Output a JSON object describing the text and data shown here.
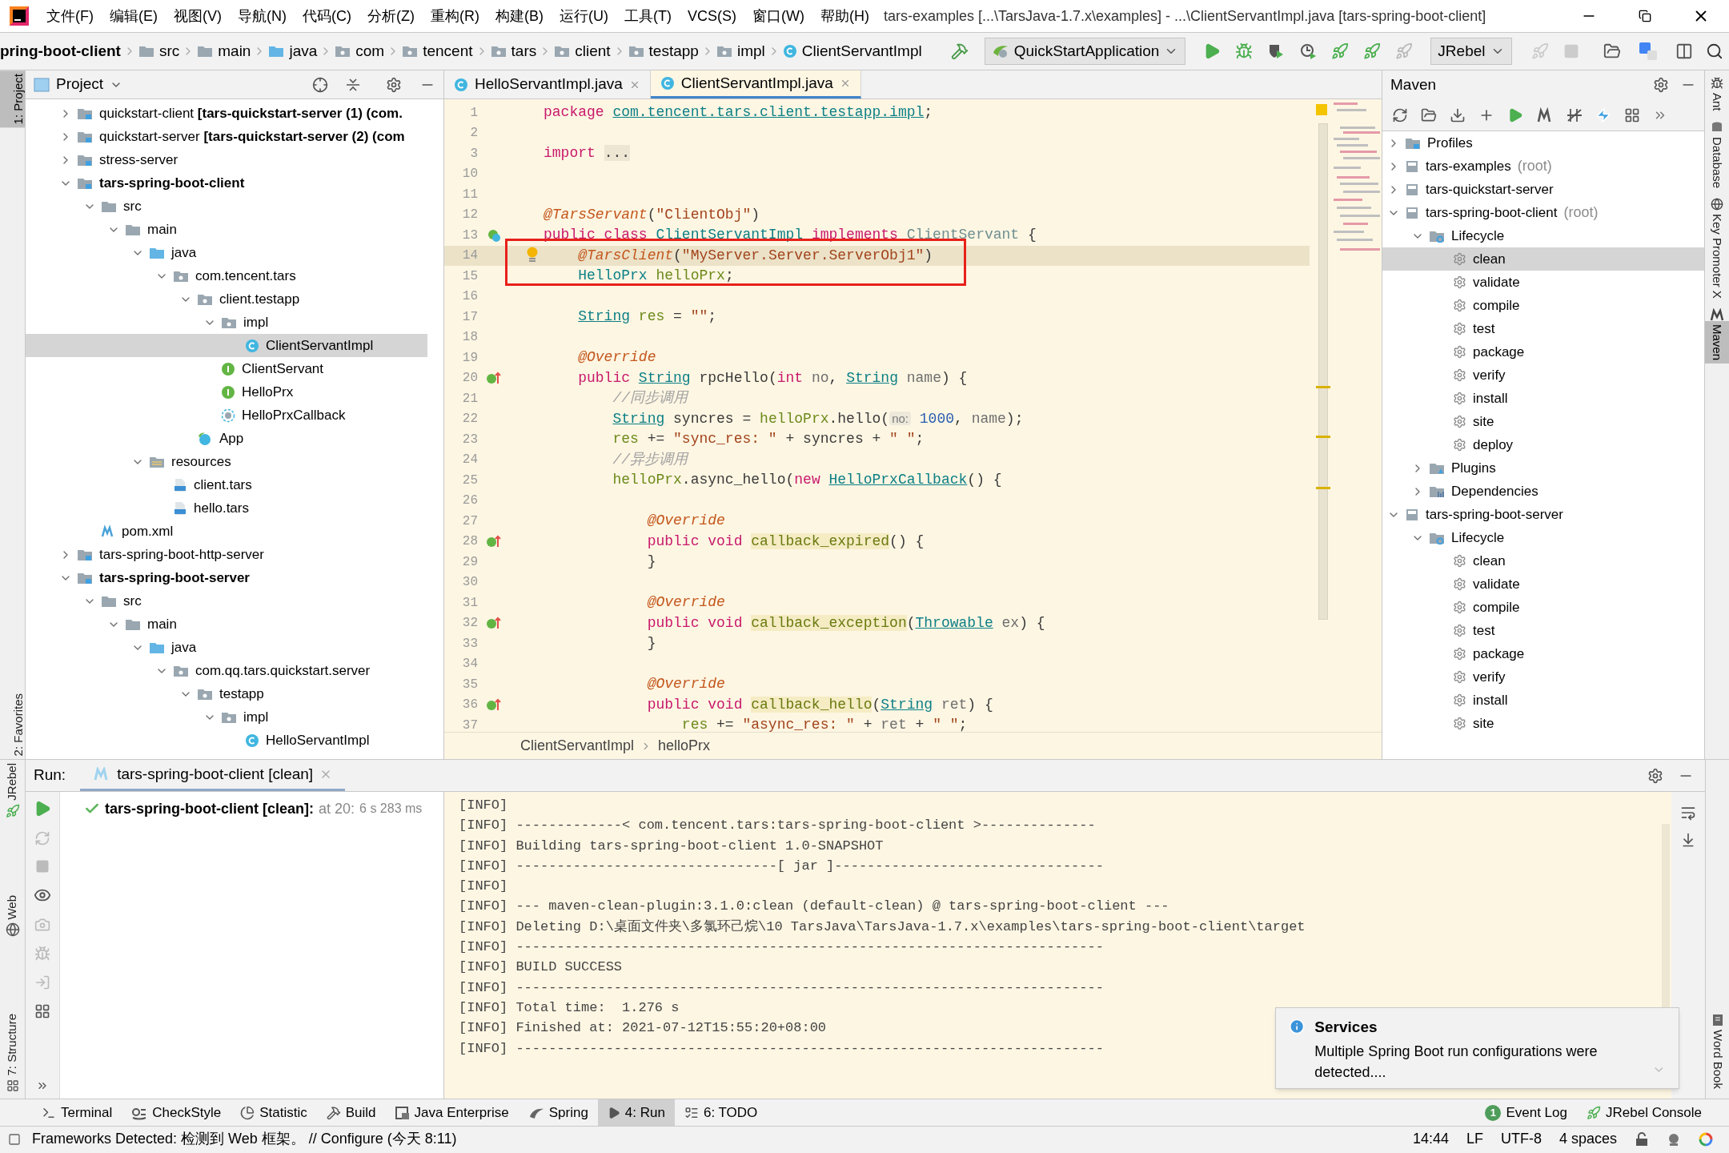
{
  "window": {
    "title": "tars-examples [...\\TarsJava-1.7.x\\examples] - ...\\ClientServantImpl.java [tars-spring-boot-client]",
    "menu": [
      "文件(F)",
      "编辑(E)",
      "视图(V)",
      "导航(N)",
      "代码(C)",
      "分析(Z)",
      "重构(R)",
      "构建(B)",
      "运行(U)",
      "工具(T)",
      "VCS(S)",
      "窗口(W)",
      "帮助(H)"
    ]
  },
  "nav_bar": {
    "crumbs": [
      {
        "label": "pring-boot-client"
      },
      {
        "label": "src",
        "kind": "folder"
      },
      {
        "label": "main",
        "kind": "folder"
      },
      {
        "label": "java",
        "kind": "src"
      },
      {
        "label": "com",
        "kind": "package"
      },
      {
        "label": "tencent",
        "kind": "package"
      },
      {
        "label": "tars",
        "kind": "package"
      },
      {
        "label": "client",
        "kind": "package"
      },
      {
        "label": "testapp",
        "kind": "package"
      },
      {
        "label": "impl",
        "kind": "package"
      },
      {
        "label": "ClientServantImpl",
        "kind": "class"
      }
    ],
    "run_config": "QuickStartApplication",
    "agent": "JRebel"
  },
  "left_stripe": {
    "top": [
      {
        "label": "1: Project",
        "selected": true
      }
    ],
    "bottom": [
      {
        "label": "2: Favorites",
        "selected": false
      },
      {
        "label": "JRebel",
        "selected": false
      },
      {
        "label": "Web",
        "selected": false
      },
      {
        "label": "7: Structure",
        "selected": false
      }
    ]
  },
  "right_stripe": {
    "top": [
      {
        "label": "Ant",
        "selected": false
      },
      {
        "label": "Database",
        "selected": false
      },
      {
        "label": "Key Promoter X",
        "selected": false
      },
      {
        "label": "Maven",
        "selected": true
      }
    ],
    "bottom": [
      {
        "label": "Word Book",
        "selected": false
      }
    ]
  },
  "project": {
    "title": "Project",
    "tree": [
      {
        "label": "quickstart-client **[tars-quickstart-server (1) (com.**",
        "kind": "module",
        "expanded": false
      },
      {
        "label": "quickstart-server **[tars-quickstart-server (2) (com**",
        "kind": "module",
        "expanded": false
      },
      {
        "label": "stress-server",
        "kind": "module",
        "expanded": false
      },
      {
        "label": "tars-spring-boot-client",
        "kind": "module",
        "bold": true,
        "expanded": true,
        "children": [
          {
            "label": "src",
            "kind": "folder",
            "expanded": true,
            "children": [
              {
                "label": "main",
                "kind": "folder",
                "expanded": true,
                "children": [
                  {
                    "label": "java",
                    "kind": "src",
                    "expanded": true,
                    "children": [
                      {
                        "label": "com.tencent.tars",
                        "kind": "package",
                        "expanded": true,
                        "children": [
                          {
                            "label": "client.testapp",
                            "kind": "package",
                            "expanded": true,
                            "children": [
                              {
                                "label": "impl",
                                "kind": "package",
                                "expanded": true,
                                "children": [
                                  {
                                    "label": "ClientServantImpl",
                                    "kind": "class",
                                    "selected": true
                                  }
                                ]
                              },
                              {
                                "label": "ClientServant",
                                "kind": "interface",
                                "selected": false
                              },
                              {
                                "label": "HelloPrx",
                                "kind": "interface",
                                "selected": false
                              },
                              {
                                "label": "HelloPrxCallback",
                                "kind": "abstract",
                                "selected": false
                              }
                            ]
                          },
                          {
                            "label": "App",
                            "kind": "spring",
                            "selected": false
                          }
                        ]
                      }
                    ]
                  },
                  {
                    "label": "resources",
                    "kind": "resources",
                    "expanded": true,
                    "children": [
                      {
                        "label": "client.tars",
                        "kind": "jce",
                        "selected": false
                      },
                      {
                        "label": "hello.tars",
                        "kind": "jce",
                        "selected": false
                      }
                    ]
                  }
                ]
              }
            ]
          },
          {
            "label": "pom.xml",
            "kind": "maven",
            "selected": false
          }
        ]
      },
      {
        "label": "tars-spring-boot-http-server",
        "kind": "module",
        "expanded": false
      },
      {
        "label": "tars-spring-boot-server",
        "kind": "module",
        "bold": true,
        "expanded": true,
        "children": [
          {
            "label": "src",
            "kind": "folder",
            "expanded": true,
            "children": [
              {
                "label": "main",
                "kind": "folder",
                "expanded": true,
                "children": [
                  {
                    "label": "java",
                    "kind": "src",
                    "expanded": true,
                    "children": [
                      {
                        "label": "com.qq.tars.quickstart.server",
                        "kind": "package",
                        "expanded": true,
                        "children": [
                          {
                            "label": "testapp",
                            "kind": "package",
                            "expanded": true,
                            "children": [
                              {
                                "label": "impl",
                                "kind": "package",
                                "expanded": true,
                                "children": [
                                  {
                                    "label": "HelloServantImpl",
                                    "kind": "class",
                                    "selected": false
                                  }
                                ]
                              }
                            ]
                          }
                        ]
                      }
                    ]
                  }
                ]
              }
            ]
          }
        ]
      }
    ]
  },
  "editor": {
    "tabs": [
      {
        "label": "HelloServantImpl.java",
        "selected": false
      },
      {
        "label": "ClientServantImpl.java",
        "selected": true
      }
    ],
    "lines": [
      {
        "no": "1",
        "segments": [
          {
            "kind": "kw",
            "text": "package "
          },
          {
            "kind": "pkg",
            "text": "com.tencent.tars.client.testapp.impl"
          },
          {
            "kind": "p",
            "text": ";"
          }
        ]
      },
      {
        "no": "2"
      },
      {
        "no": "3",
        "segments": [
          {
            "kind": "kw",
            "text": "import "
          },
          {
            "kind": "fold",
            "text": "..."
          }
        ]
      },
      {
        "no": "10"
      },
      {
        "no": "11"
      },
      {
        "no": "12",
        "segments": [
          {
            "kind": "ann",
            "text": "@TarsServant"
          },
          {
            "kind": "p",
            "text": "("
          },
          {
            "kind": "str",
            "text": "\"ClientObj\""
          },
          {
            "kind": "p",
            "text": ")"
          }
        ]
      },
      {
        "no": "13",
        "kind": "bean",
        "segments": [
          {
            "kind": "kw",
            "text": "public class "
          },
          {
            "kind": "type",
            "text": "ClientServantImpl"
          },
          {
            "kind": "kw",
            "text": " implements "
          },
          {
            "kind": "dim",
            "text": "ClientServant"
          },
          {
            "kind": "p",
            "text": " {"
          }
        ]
      },
      {
        "no": "14",
        "current": true,
        "bulb": true,
        "boxed": true,
        "segments": [
          {
            "kind": "ann",
            "text": "    @TarsClient"
          },
          {
            "kind": "p",
            "text": "("
          },
          {
            "kind": "str",
            "text": "\"MyServer.Server.ServerObj1\""
          },
          {
            "kind": "p",
            "text": ")"
          }
        ]
      },
      {
        "no": "15",
        "boxed": true,
        "segments": [
          {
            "kind": "cls",
            "text": "    HelloPrx"
          },
          {
            "kind": "field",
            "text": " helloPrx"
          },
          {
            "kind": "p",
            "text": ";"
          }
        ]
      },
      {
        "no": "16"
      },
      {
        "no": "17",
        "segments": [
          {
            "kind": "type",
            "text": "    String"
          },
          {
            "kind": "field",
            "text": " res"
          },
          {
            "kind": "p",
            "text": " = "
          },
          {
            "kind": "str",
            "text": "\"\""
          },
          {
            "kind": "p",
            "text": ";"
          }
        ]
      },
      {
        "no": "18"
      },
      {
        "no": "19",
        "segments": [
          {
            "kind": "ann",
            "text": "    @Override"
          }
        ]
      },
      {
        "no": "20",
        "kind": "implements",
        "segments": [
          {
            "kind": "kw",
            "text": "    public "
          },
          {
            "kind": "type",
            "text": "String"
          },
          {
            "kind": "p",
            "text": " rpcHello("
          },
          {
            "kind": "kw",
            "text": "int"
          },
          {
            "kind": "param",
            "text": " no"
          },
          {
            "kind": "p",
            "text": ", "
          },
          {
            "kind": "type",
            "text": "String"
          },
          {
            "kind": "param",
            "text": " name"
          },
          {
            "kind": "p",
            "text": ") {"
          }
        ]
      },
      {
        "no": "21",
        "segments": [
          {
            "kind": "comment",
            "text": "        //同步调用"
          }
        ]
      },
      {
        "no": "22",
        "segments": [
          {
            "kind": "type",
            "text": "        String"
          },
          {
            "kind": "p",
            "text": " syncres = "
          },
          {
            "kind": "field",
            "text": "helloPrx"
          },
          {
            "kind": "p",
            "text": ".hello("
          },
          {
            "kind": "hint",
            "text": "no:"
          },
          {
            "kind": "num",
            "text": " 1000"
          },
          {
            "kind": "p",
            "text": ", "
          },
          {
            "kind": "param",
            "text": "name"
          },
          {
            "kind": "p",
            "text": ");"
          }
        ]
      },
      {
        "no": "23",
        "segments": [
          {
            "kind": "field",
            "text": "        res"
          },
          {
            "kind": "p",
            "text": " += "
          },
          {
            "kind": "str",
            "text": "\"sync_res: \""
          },
          {
            "kind": "p",
            "text": " + syncres + "
          },
          {
            "kind": "str",
            "text": "\" \""
          },
          {
            "kind": "p",
            "text": ";"
          }
        ]
      },
      {
        "no": "24",
        "segments": [
          {
            "kind": "comment",
            "text": "        //异步调用"
          }
        ]
      },
      {
        "no": "25",
        "segments": [
          {
            "kind": "field",
            "text": "        helloPrx"
          },
          {
            "kind": "p",
            "text": ".async_hello("
          },
          {
            "kind": "kw",
            "text": "new "
          },
          {
            "kind": "type",
            "text": "HelloPrxCallback"
          },
          {
            "kind": "p",
            "text": "() {"
          }
        ]
      },
      {
        "no": "26"
      },
      {
        "no": "27",
        "segments": [
          {
            "kind": "ann",
            "text": "            @Override"
          }
        ]
      },
      {
        "no": "28",
        "kind": "implements",
        "segments": [
          {
            "kind": "kw",
            "text": "            public void "
          },
          {
            "kind": "meth",
            "text": "callback_expired"
          },
          {
            "kind": "p",
            "text": "() {"
          }
        ]
      },
      {
        "no": "29",
        "segments": [
          {
            "kind": "p",
            "text": "            }"
          }
        ]
      },
      {
        "no": "30"
      },
      {
        "no": "31",
        "segments": [
          {
            "kind": "ann",
            "text": "            @Override"
          }
        ]
      },
      {
        "no": "32",
        "kind": "implements",
        "segments": [
          {
            "kind": "kw",
            "text": "            public void "
          },
          {
            "kind": "meth",
            "text": "callback_exception"
          },
          {
            "kind": "p",
            "text": "("
          },
          {
            "kind": "type",
            "text": "Throwable"
          },
          {
            "kind": "param",
            "text": " ex"
          },
          {
            "kind": "p",
            "text": ") {"
          }
        ]
      },
      {
        "no": "33",
        "segments": [
          {
            "kind": "p",
            "text": "            }"
          }
        ]
      },
      {
        "no": "34"
      },
      {
        "no": "35",
        "segments": [
          {
            "kind": "ann",
            "text": "            @Override"
          }
        ]
      },
      {
        "no": "36",
        "kind": "implements",
        "segments": [
          {
            "kind": "kw",
            "text": "            public void "
          },
          {
            "kind": "meth",
            "text": "callback_hello"
          },
          {
            "kind": "p",
            "text": "("
          },
          {
            "kind": "type",
            "text": "String"
          },
          {
            "kind": "param",
            "text": " ret"
          },
          {
            "kind": "p",
            "text": ") {"
          }
        ]
      },
      {
        "no": "37",
        "segments": [
          {
            "kind": "field",
            "text": "                res"
          },
          {
            "kind": "p",
            "text": " += "
          },
          {
            "kind": "str",
            "text": "\"async_res: \""
          },
          {
            "kind": "p",
            "text": " + "
          },
          {
            "kind": "param",
            "text": "ret"
          },
          {
            "kind": "p",
            "text": " + "
          },
          {
            "kind": "str",
            "text": "\" \""
          },
          {
            "kind": "p",
            "text": ";"
          }
        ]
      }
    ],
    "breadcrumb": [
      "ClientServantImpl",
      "helloPrx"
    ]
  },
  "maven": {
    "title": "Maven",
    "tree": [
      {
        "label": "Profiles",
        "kind": "profiles",
        "expanded": false
      },
      {
        "label": "tars-examples",
        "note": "(root)",
        "kind": "mproject",
        "expanded": false
      },
      {
        "label": "tars-quickstart-server",
        "kind": "mproject",
        "expanded": false
      },
      {
        "label": "tars-spring-boot-client",
        "note": "(root)",
        "kind": "mproject",
        "expanded": true,
        "children": [
          {
            "label": "Lifecycle",
            "kind": "lifecycle",
            "expanded": true,
            "children": [
              {
                "label": "clean",
                "kind": "gear",
                "selected": true
              },
              {
                "label": "validate",
                "kind": "gear",
                "selected": false
              },
              {
                "label": "compile",
                "kind": "gear",
                "selected": false
              },
              {
                "label": "test",
                "kind": "gear",
                "selected": false
              },
              {
                "label": "package",
                "kind": "gear",
                "selected": false
              },
              {
                "label": "verify",
                "kind": "gear",
                "selected": false
              },
              {
                "label": "install",
                "kind": "gear",
                "selected": false
              },
              {
                "label": "site",
                "kind": "gear",
                "selected": false
              },
              {
                "label": "deploy",
                "kind": "gear",
                "selected": false
              }
            ]
          },
          {
            "label": "Plugins",
            "kind": "plugins",
            "expanded": false
          },
          {
            "label": "Dependencies",
            "kind": "deps",
            "expanded": false
          }
        ]
      },
      {
        "label": "tars-spring-boot-server",
        "kind": "mproject",
        "expanded": true,
        "children": [
          {
            "label": "Lifecycle",
            "kind": "lifecycle",
            "expanded": true,
            "children": [
              {
                "label": "clean",
                "kind": "gear",
                "selected": false
              },
              {
                "label": "validate",
                "kind": "gear",
                "selected": false
              },
              {
                "label": "compile",
                "kind": "gear",
                "selected": false
              },
              {
                "label": "test",
                "kind": "gear",
                "selected": false
              },
              {
                "label": "package",
                "kind": "gear",
                "selected": false
              },
              {
                "label": "verify",
                "kind": "gear",
                "selected": false
              },
              {
                "label": "install",
                "kind": "gear",
                "selected": false
              },
              {
                "label": "site",
                "kind": "gear",
                "selected": false
              }
            ]
          }
        ]
      }
    ]
  },
  "run": {
    "label": "Run:",
    "tab": "tars-spring-boot-client [clean]",
    "result": {
      "name": "tars-spring-boot-client [clean]:",
      "time": "at 20:",
      "duration": "6 s 283 ms",
      "success": true
    },
    "console": [
      "[INFO]",
      "[INFO] -------------< com.tencent.tars:tars-spring-boot-client >--------------",
      "[INFO] Building tars-spring-boot-client 1.0-SNAPSHOT",
      "[INFO] --------------------------------[ jar ]---------------------------------",
      "[INFO]",
      "[INFO] --- maven-clean-plugin:3.1.0:clean (default-clean) @ tars-spring-boot-client ---",
      "[INFO] Deleting D:\\桌面文件夹\\多氯环己烷\\10 TarsJava\\TarsJava-1.7.x\\examples\\tars-spring-boot-client\\target",
      "[INFO] ------------------------------------------------------------------------",
      "[INFO] BUILD SUCCESS",
      "[INFO] ------------------------------------------------------------------------",
      "[INFO] Total time:  1.276 s",
      "[INFO] Finished at: 2021-07-12T15:55:20+08:00",
      "[INFO] ------------------------------------------------------------------------"
    ]
  },
  "notification": {
    "title": "Services",
    "message": "Multiple Spring Boot run configurations were detected...."
  },
  "tool_windows": {
    "left": [
      {
        "label": "Terminal",
        "kind": "terminal",
        "selected": false
      },
      {
        "label": "CheckStyle",
        "kind": "checkstyle",
        "selected": false
      },
      {
        "label": "Statistic",
        "kind": "statistic",
        "selected": false
      },
      {
        "label": "Build",
        "kind": "build",
        "selected": false
      },
      {
        "label": "Java Enterprise",
        "kind": "enterprise",
        "selected": false
      },
      {
        "label": "Spring",
        "kind": "spring",
        "selected": false
      },
      {
        "label": "4: Run",
        "kind": "run",
        "selected": true
      },
      {
        "label": "6: TODO",
        "kind": "todo",
        "selected": false
      }
    ],
    "right": [
      {
        "label": "Event Log",
        "badge": "1"
      },
      {
        "label": "JRebel Console"
      }
    ]
  },
  "status_bar": {
    "message": "Frameworks Detected: 检测到 Web 框架。 // Configure (今天 8:11)",
    "items": [
      "14:44",
      "LF",
      "UTF-8",
      "4 spaces"
    ]
  }
}
